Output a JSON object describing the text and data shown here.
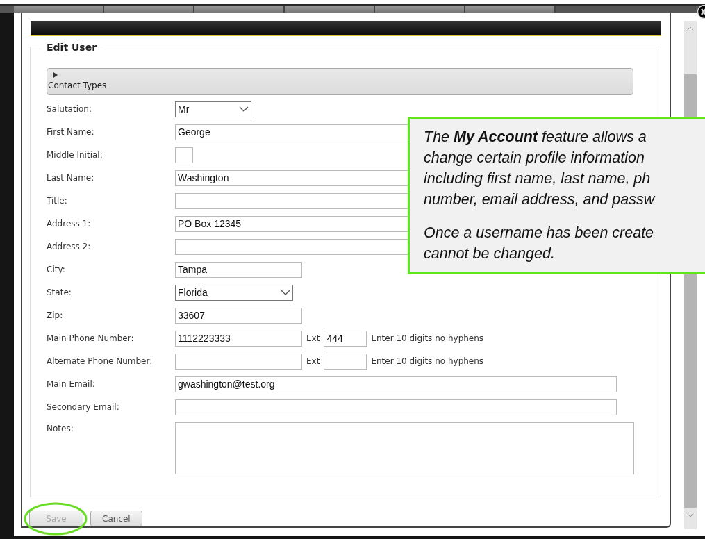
{
  "form": {
    "legend": "Edit User",
    "contact_types": {
      "label": "Contact Types",
      "expanded": false
    },
    "fields": [
      {
        "kind": "select-short",
        "label": "Salutation:",
        "value": "Mr"
      },
      {
        "kind": "text",
        "label": "First Name:",
        "value": "George"
      },
      {
        "kind": "initial",
        "label": "Middle Initial:"
      },
      {
        "kind": "text",
        "label": "Last Name:",
        "value": "Washington"
      },
      {
        "kind": "text",
        "label": "Title:"
      },
      {
        "kind": "text",
        "label": "Address 1:",
        "value": "PO Box 12345"
      },
      {
        "kind": "text",
        "label": "Address 2:"
      },
      {
        "kind": "short",
        "label": "City:",
        "value": "Tampa"
      },
      {
        "kind": "select",
        "label": "State:",
        "value": "Florida"
      },
      {
        "kind": "short",
        "label": "Zip:",
        "value": "33607"
      },
      {
        "kind": "phone",
        "label": "Main Phone Number:",
        "value": "1112223333",
        "ext_label": "Ext",
        "ext_value": "444",
        "hint": "Enter 10 digits no hyphens"
      },
      {
        "kind": "phone",
        "label": "Alternate Phone Number:",
        "ext_label": "Ext",
        "hint": "Enter 10 digits no hyphens"
      },
      {
        "kind": "text",
        "label": "Main Email:",
        "value": "gwashington@test.org"
      },
      {
        "kind": "text",
        "label": "Secondary Email:"
      },
      {
        "kind": "textarea",
        "label": "Notes:"
      }
    ]
  },
  "buttons": [
    {
      "label": "Save",
      "disabled": true,
      "highlighted": true
    },
    {
      "label": "Cancel",
      "disabled": false,
      "highlighted": false
    }
  ],
  "callout": {
    "paragraphs": [
      {
        "lines": [
          "The **My Account** feature allows a",
          "change certain profile information",
          "including first name, last name, ph",
          "number, email address, and passw"
        ]
      },
      {
        "lines": [
          "Once a username has been create",
          "cannot be changed."
        ]
      }
    ]
  }
}
